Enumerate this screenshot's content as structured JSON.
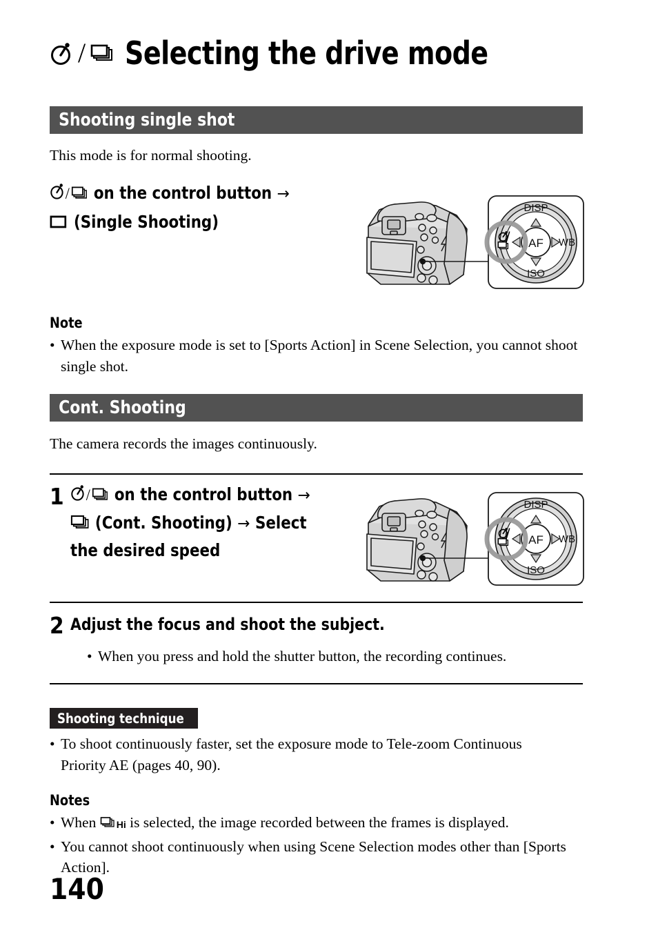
{
  "page": {
    "number": "140",
    "title": "Selecting the drive mode",
    "title_icons": [
      "self-timer-icon",
      "continuous-shooting-icon"
    ]
  },
  "sections": [
    {
      "id": "shooting-single-shot",
      "header": "Shooting single shot",
      "intro": "This mode is for normal shooting.",
      "instruction": {
        "line1_text": "on the control button",
        "arrow": "→",
        "line2_text": "(Single Shooting)",
        "icons": [
          "self-timer-icon",
          "continuous-shooting-icon",
          "single-shooting-icon"
        ]
      },
      "notes": {
        "heading": "Note",
        "items": [
          "When the exposure mode is set to [Sports Action] in Scene Selection, you cannot shoot single shot."
        ]
      }
    },
    {
      "id": "cont-shooting",
      "header": "Cont. Shooting",
      "intro": "The camera records the images continuously.",
      "steps": [
        {
          "number": "1",
          "line1_text": "on the control button",
          "line2_text": "(Cont. Shooting)",
          "line2_tail": "Select",
          "line3_text": "the desired speed",
          "arrow": "→"
        },
        {
          "number": "2",
          "text": "Adjust the focus and shoot the subject.",
          "bullets": [
            "When you press and hold the shutter button, the recording continues."
          ]
        }
      ],
      "technique": {
        "badge": "Shooting technique",
        "items": [
          "To shoot continuously faster, set the exposure mode to Tele-zoom Continuous Priority AE (pages 40, 90)."
        ]
      },
      "notes": {
        "heading": "Notes",
        "items_pre": "When ",
        "items": [
          {
            "pre": "When ",
            "icon": "continuous-shooting-hi-icon",
            "icon_label": "Hi",
            "post": " is selected, the image recorded between the frames is displayed."
          },
          {
            "pre": "",
            "icon": "",
            "icon_label": "",
            "post": "You cannot shoot continuously when using Scene Selection modes other than [Sports Action]."
          }
        ]
      }
    }
  ],
  "illustration": {
    "name": "camera-control-wheel-diagram",
    "wheel_labels": {
      "top": "DISP",
      "right": "WB",
      "bottom": "ISO",
      "center": "AF"
    },
    "highlight": "drive-mode-button"
  },
  "colors": {
    "section_bar": "#525252",
    "badge": "#231f20",
    "text": "#000000",
    "illustration_fill": "#d4d4d4"
  }
}
